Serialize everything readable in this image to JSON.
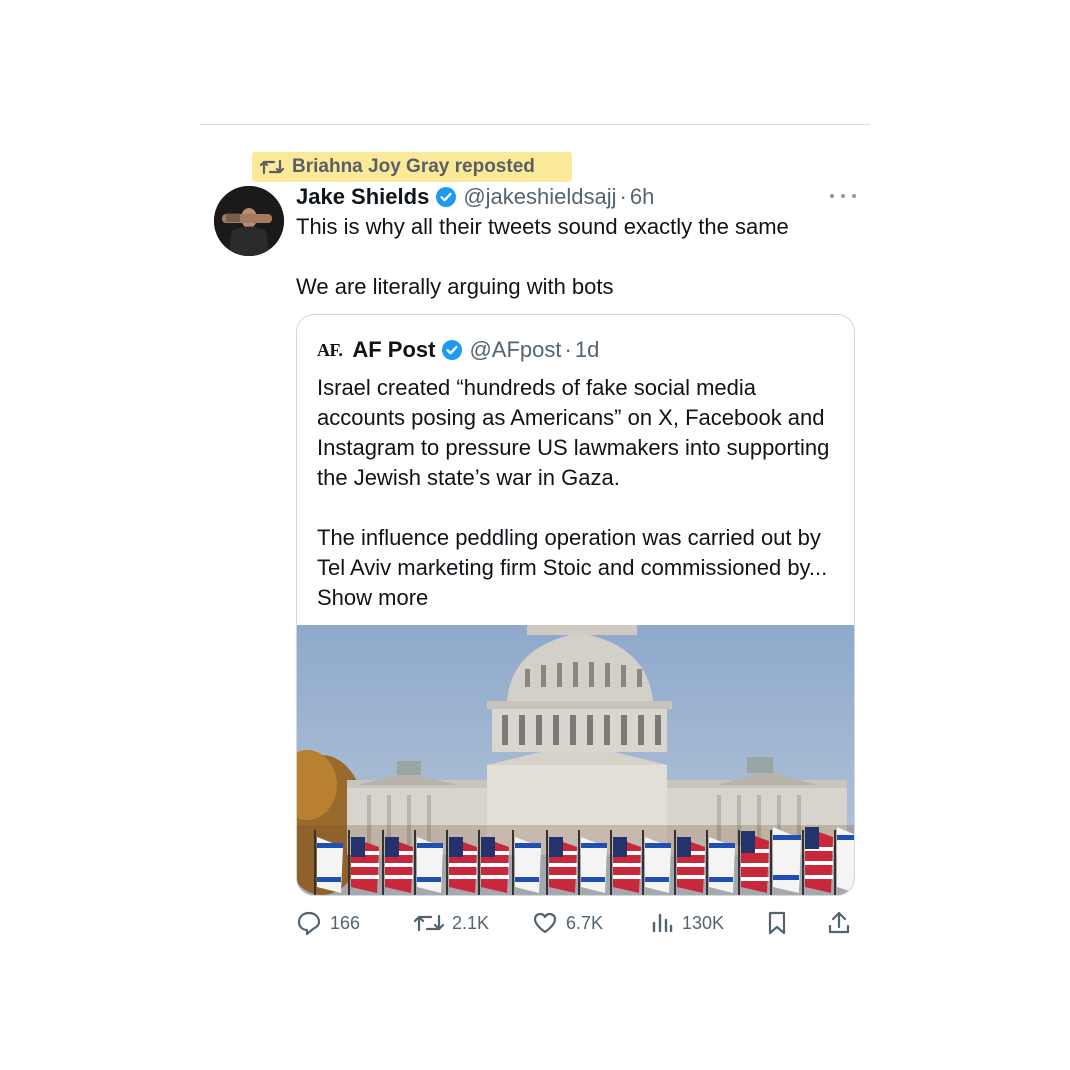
{
  "repost": {
    "label": "Briahna Joy Gray reposted",
    "icon": "repost-icon"
  },
  "tweet": {
    "author_name": "Jake Shields",
    "handle": "@jakeshieldsajj",
    "separator": "·",
    "time": "6h",
    "text_line1": "This is why all their tweets sound exactly the same",
    "text_line2": "We are literally arguing with bots"
  },
  "quote": {
    "logo": "AF.",
    "author_name": "AF Post",
    "handle": "@AFpost",
    "separator": "·",
    "time": "1d",
    "paragraph1": "Israel created “hundreds of fake social media accounts posing as Americans” on X, Facebook and Instagram to pressure US lawmakers into supporting the Jewish state’s war in Gaza.",
    "paragraph2": "The influence peddling operation was carried out by Tel Aviv marketing firm Stoic and commissioned by...",
    "show_more": "Show more"
  },
  "actions": {
    "replies": "166",
    "reposts": "2.1K",
    "likes": "6.7K",
    "views": "130K"
  },
  "colors": {
    "highlight": "#fbe99a",
    "verified": "#1d9bf0",
    "muted": "#536471",
    "border": "#cfd9de"
  }
}
